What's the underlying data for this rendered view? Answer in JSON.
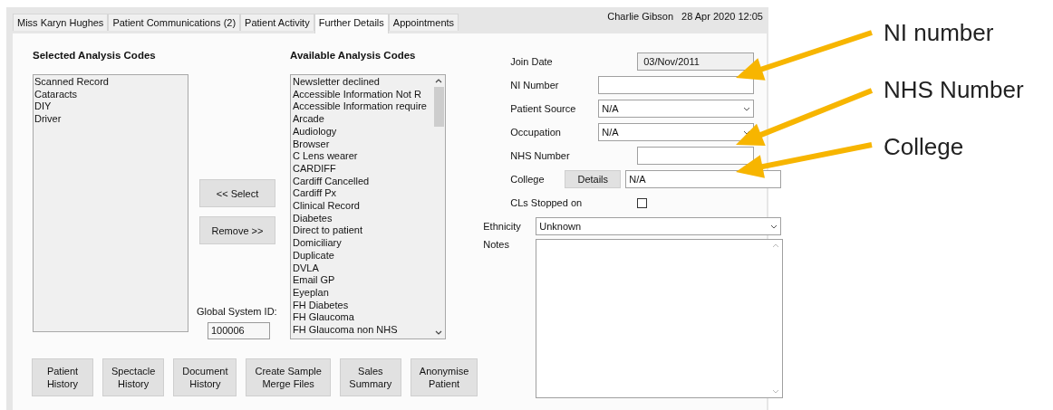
{
  "tabs": [
    {
      "label": "Miss Karyn Hughes",
      "selected": false
    },
    {
      "label": "Patient Communications (2)",
      "selected": false
    },
    {
      "label": "Patient Activity",
      "selected": false
    },
    {
      "label": "Further Details",
      "selected": true
    },
    {
      "label": "Appointments",
      "selected": false
    }
  ],
  "header": {
    "user": "Charlie Gibson",
    "datetime": "28 Apr 2020 12:05"
  },
  "selected_codes": {
    "title": "Selected Analysis Codes",
    "items": [
      "Scanned Record",
      "Cataracts",
      "DIY",
      "Driver"
    ]
  },
  "move_buttons": [
    "<< Select",
    "Remove >>"
  ],
  "global_system_id": {
    "label": "Global System ID:",
    "value": "100006"
  },
  "available_codes": {
    "title": "Available Analysis Codes",
    "items": [
      "Newsletter declined",
      "Accessible Information Not R",
      "Accessible Information require",
      "Arcade",
      "Audiology",
      "Browser",
      "C Lens wearer",
      "CARDIFF",
      "Cardiff Cancelled",
      "Cardiff Px",
      "Clinical Record",
      "Diabetes",
      "Direct to patient",
      "Domiciliary",
      "Duplicate",
      "DVLA",
      "Email GP",
      "Eyeplan",
      "FH Diabetes",
      "FH Glaucoma",
      "FH Glaucoma non NHS"
    ]
  },
  "form": {
    "fields": [
      {
        "kind": "readonly",
        "label": "Join Date",
        "value": "03/Nov/2011"
      },
      {
        "kind": "text",
        "label": "NI Number"
      },
      {
        "kind": "select",
        "label": "Patient Source",
        "value": "N/A"
      },
      {
        "kind": "select",
        "label": "Occupation",
        "value": "N/A"
      },
      {
        "kind": "short_text",
        "label": "NHS Number"
      },
      {
        "kind": "select_button",
        "label": "College",
        "button": "Details",
        "value": "N/A"
      },
      {
        "kind": "checkbox",
        "label": "CLs Stopped on",
        "checked": false
      }
    ],
    "ethnicity": {
      "label": "Ethnicity",
      "value": "Unknown"
    },
    "notes": {
      "label": "Notes"
    }
  },
  "actions": [
    {
      "lines": [
        "Patient",
        "History"
      ]
    },
    {
      "lines": [
        "Spectacle",
        "History"
      ]
    },
    {
      "lines": [
        "Document",
        "History"
      ]
    },
    {
      "lines": [
        "Create Sample",
        "Merge Files"
      ]
    },
    {
      "lines": [
        "Sales",
        "Summary"
      ]
    },
    {
      "lines": [
        "Anonymise",
        "Patient"
      ]
    }
  ],
  "annotations": [
    {
      "label": "NI number"
    },
    {
      "label": "NHS Number"
    },
    {
      "label": "College"
    }
  ]
}
